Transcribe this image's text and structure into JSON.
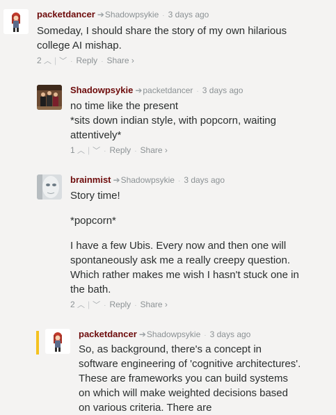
{
  "comments": [
    {
      "author": "packetdancer",
      "parent": "Shadowpsykie",
      "time": "3 days ago",
      "paragraphs": [
        "Someday, I should share the story of my own hilarious college AI mishap."
      ],
      "votes": "2",
      "reply": "Reply",
      "share": "Share ›"
    },
    {
      "author": "Shadowpsykie",
      "parent": "packetdancer",
      "time": "3 days ago",
      "paragraphs": [
        "no time like the present",
        "*sits down indian style, with popcorn, waiting attentively*"
      ],
      "votes": "1",
      "reply": "Reply",
      "share": "Share ›"
    },
    {
      "author": "brainmist",
      "parent": "Shadowpsykie",
      "time": "3 days ago",
      "paragraphs": [
        "Story time!",
        "*popcorn*",
        "I have a few Ubis. Every now and then one will spontaneously ask me a really creepy question. Which rather makes me wish I hasn't stuck one in the bath."
      ],
      "votes": "2",
      "reply": "Reply",
      "share": "Share ›"
    },
    {
      "author": "packetdancer",
      "parent": "Shadowpsykie",
      "time": "3 days ago",
      "paragraphs": [
        "So, as background, there's a concept in software engineering of 'cognitive architectures'. These are frameworks you can build systems on which will make weighted decisions based on various criteria. There are"
      ],
      "votes": "",
      "reply": "",
      "share": ""
    }
  ],
  "icons": {
    "reply_arrow": "reply-arrow-icon",
    "upvote": "chevron-up-icon",
    "downvote": "chevron-down-icon"
  },
  "colors": {
    "author": "#6d0b0b",
    "meta": "#8b9194",
    "background": "#f4f3f2",
    "highlight": "#f4c220"
  }
}
